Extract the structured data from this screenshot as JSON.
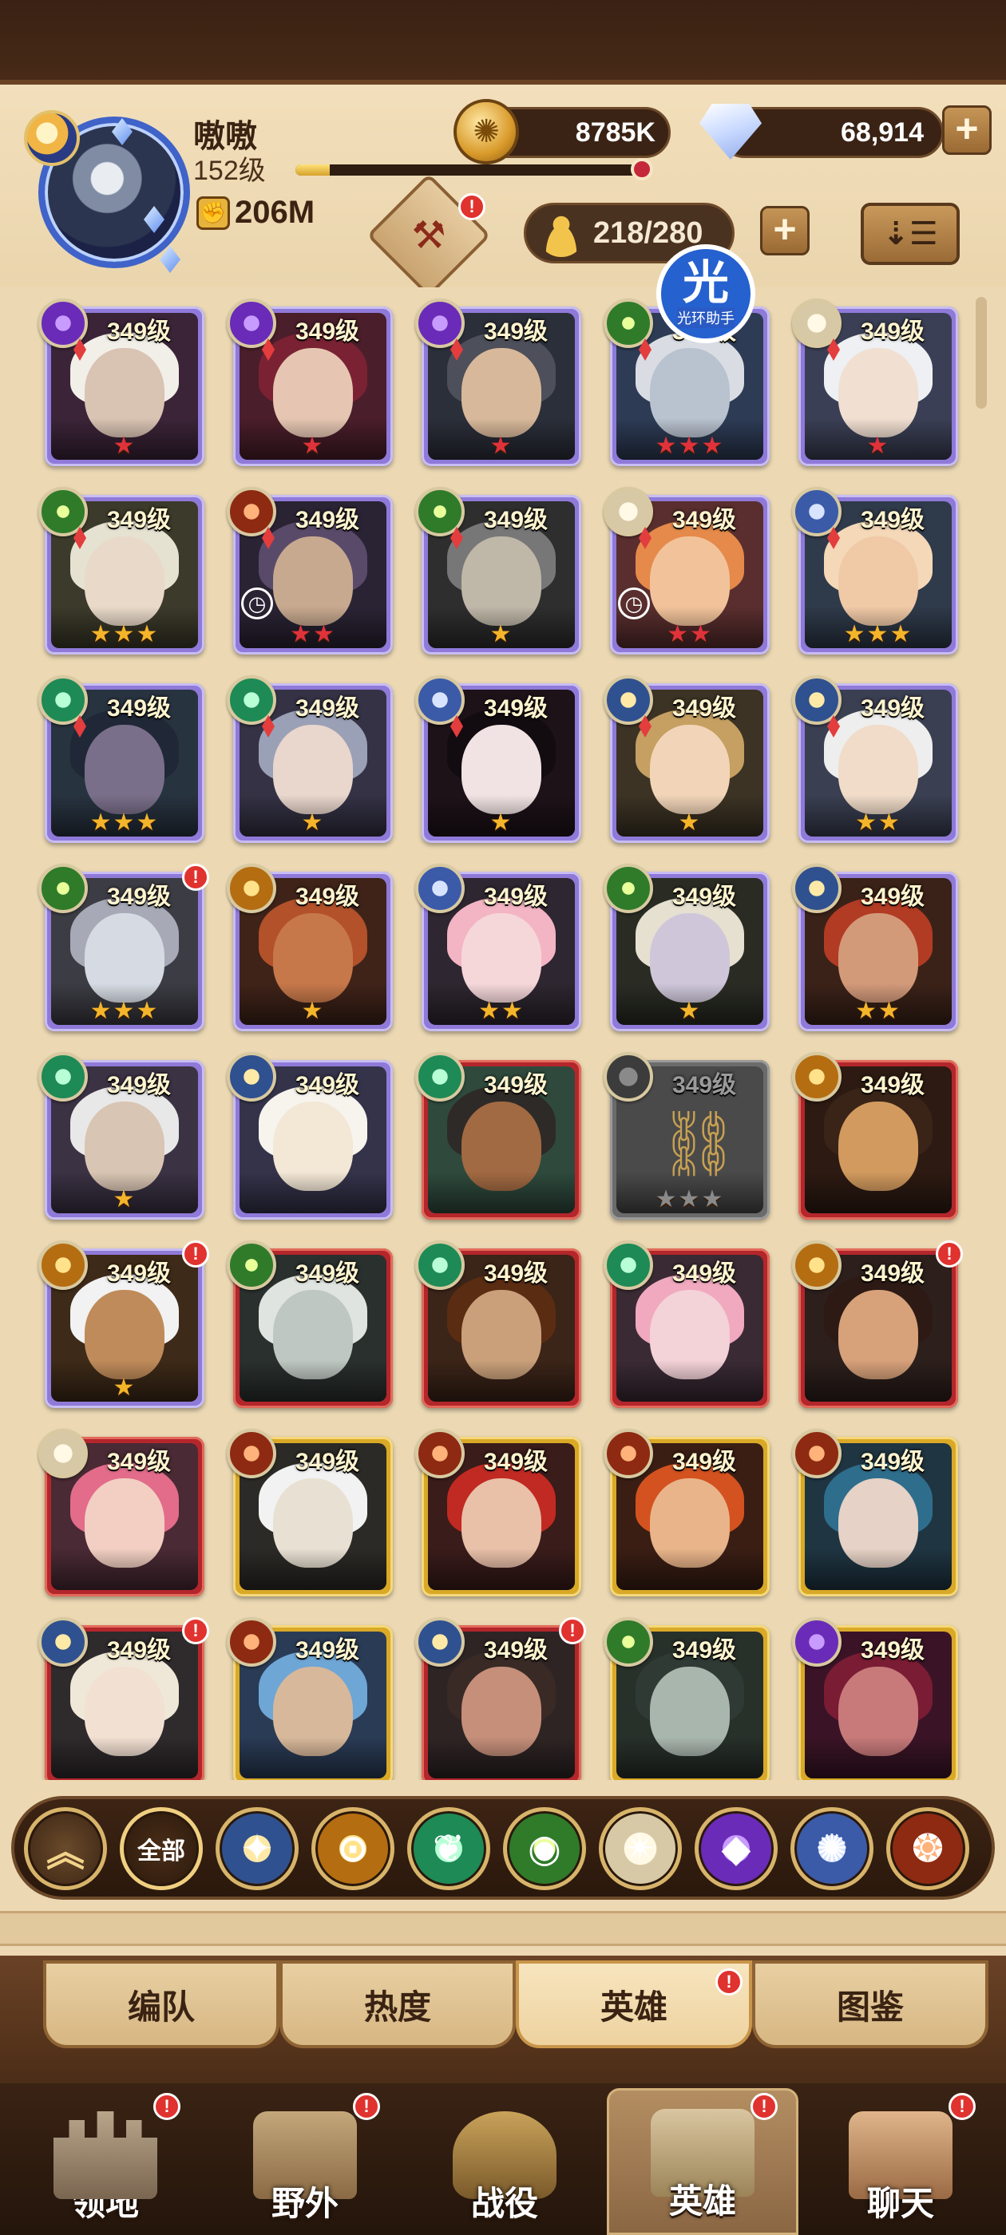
{
  "player": {
    "name": "嗷嗷",
    "level": "152级",
    "power": "206M",
    "xp_progress": 0.1
  },
  "currency": {
    "gold": "8785K",
    "diamonds": "68,914",
    "plus": "+"
  },
  "heroes_header": {
    "slot_count": "218/280",
    "plus": "+",
    "sort_icon": "⇣☰",
    "dismantle_badge": "!"
  },
  "helper_overlay": {
    "glyph": "光",
    "label": "光环助手"
  },
  "heroes": [
    {
      "level": "349级",
      "faction": "hypogean",
      "frame": "purple",
      "stars": "★",
      "badge": ""
    },
    {
      "level": "349级",
      "faction": "hypogean",
      "frame": "purple",
      "stars": "★",
      "badge": ""
    },
    {
      "level": "349级",
      "faction": "hypogean",
      "frame": "purple",
      "stars": "★",
      "badge": ""
    },
    {
      "level": "349级",
      "faction": "wilder",
      "frame": "purple",
      "stars": "★★★",
      "badge": ""
    },
    {
      "level": "349级",
      "faction": "celestial",
      "frame": "purple",
      "stars": "★",
      "badge": ""
    },
    {
      "level": "349级",
      "faction": "wilder",
      "frame": "purple",
      "stars": "★★★",
      "badge": ""
    },
    {
      "level": "349级",
      "faction": "graveborn",
      "frame": "purple",
      "stars": "★★",
      "badge": "",
      "clock": "◷"
    },
    {
      "level": "349级",
      "faction": "wilder",
      "frame": "purple",
      "stars": "★",
      "badge": ""
    },
    {
      "level": "349级",
      "faction": "celestial",
      "frame": "purple",
      "stars": "★★",
      "badge": "",
      "clock": "◷"
    },
    {
      "level": "349级",
      "faction": "dimensional",
      "frame": "purple",
      "stars": "★★★",
      "badge": ""
    },
    {
      "level": "349级",
      "faction": "maulers",
      "frame": "purple",
      "stars": "★★★",
      "badge": ""
    },
    {
      "level": "349级",
      "faction": "maulers",
      "frame": "purple",
      "stars": "★",
      "badge": ""
    },
    {
      "level": "349级",
      "faction": "dimensional",
      "frame": "purple",
      "stars": "★",
      "badge": ""
    },
    {
      "level": "349级",
      "faction": "lightbearer",
      "frame": "purple",
      "stars": "★",
      "badge": ""
    },
    {
      "level": "349级",
      "faction": "lightbearer",
      "frame": "purple",
      "stars": "★★",
      "badge": ""
    },
    {
      "level": "349级",
      "faction": "wilder",
      "frame": "purple",
      "stars": "★★★",
      "badge": "!"
    },
    {
      "level": "349级",
      "faction": "mauler2",
      "frame": "purple",
      "stars": "★",
      "badge": ""
    },
    {
      "level": "349级",
      "faction": "dimensional",
      "frame": "purple",
      "stars": "★★",
      "badge": ""
    },
    {
      "level": "349级",
      "faction": "wilder",
      "frame": "purple",
      "stars": "★",
      "badge": ""
    },
    {
      "level": "349级",
      "faction": "lightbearer",
      "frame": "purple",
      "stars": "★★",
      "badge": ""
    },
    {
      "level": "349级",
      "faction": "maulers",
      "frame": "purple",
      "stars": "★",
      "badge": ""
    },
    {
      "level": "349级",
      "faction": "lightbearer",
      "frame": "purple",
      "stars": "",
      "badge": ""
    },
    {
      "level": "349级",
      "faction": "maulers",
      "frame": "red",
      "stars": "",
      "badge": ""
    },
    {
      "level": "349级",
      "faction": "locked",
      "frame": "grey",
      "stars": "★★★",
      "badge": "",
      "locked": true
    },
    {
      "level": "349级",
      "faction": "mauler2",
      "frame": "red",
      "stars": "",
      "badge": ""
    },
    {
      "level": "349级",
      "faction": "mauler2",
      "frame": "purple",
      "stars": "★",
      "badge": "!"
    },
    {
      "level": "349级",
      "faction": "wilder",
      "frame": "red",
      "stars": "",
      "badge": ""
    },
    {
      "level": "349级",
      "faction": "maulers",
      "frame": "red",
      "stars": "",
      "badge": ""
    },
    {
      "level": "349级",
      "faction": "maulers",
      "frame": "red",
      "stars": "",
      "badge": ""
    },
    {
      "level": "349级",
      "faction": "mauler2",
      "frame": "red",
      "stars": "",
      "badge": "!"
    },
    {
      "level": "349级",
      "faction": "celestial",
      "frame": "red",
      "stars": "",
      "badge": ""
    },
    {
      "level": "349级",
      "faction": "graveborn",
      "frame": "gold",
      "stars": "",
      "badge": ""
    },
    {
      "level": "349级",
      "faction": "graveborn",
      "frame": "gold",
      "stars": "",
      "badge": ""
    },
    {
      "level": "349级",
      "faction": "graveborn",
      "frame": "gold",
      "stars": "",
      "badge": ""
    },
    {
      "level": "349级",
      "faction": "graveborn",
      "frame": "gold",
      "stars": "",
      "badge": ""
    },
    {
      "level": "349级",
      "faction": "lightbearer",
      "frame": "red",
      "stars": "",
      "badge": "!"
    },
    {
      "level": "349级",
      "faction": "graveborn",
      "frame": "gold",
      "stars": "",
      "badge": ""
    },
    {
      "level": "349级",
      "faction": "lightbearer",
      "frame": "red",
      "stars": "",
      "badge": "!"
    },
    {
      "level": "349级",
      "faction": "wilder",
      "frame": "gold",
      "stars": "",
      "badge": ""
    },
    {
      "level": "349级",
      "faction": "hypogean",
      "frame": "gold",
      "stars": "",
      "badge": ""
    }
  ],
  "filters": [
    {
      "name": "filter-rank-up",
      "label": "︽",
      "kind": "rank"
    },
    {
      "name": "filter-all",
      "label": "全部",
      "kind": "all"
    },
    {
      "name": "filter-lightbearer",
      "label": "✦",
      "kind": "lightbearer"
    },
    {
      "name": "filter-mauler",
      "label": "⊙",
      "kind": "mauler2"
    },
    {
      "name": "filter-wilder",
      "label": "❦",
      "kind": "maulers"
    },
    {
      "name": "filter-graveborn",
      "label": "◉",
      "kind": "wilder"
    },
    {
      "name": "filter-celestial",
      "label": "✴",
      "kind": "celestial"
    },
    {
      "name": "filter-hypogean",
      "label": "◆",
      "kind": "hypogean"
    },
    {
      "name": "filter-dimensional",
      "label": "✺",
      "kind": "dimensional"
    },
    {
      "name": "filter-special",
      "label": "❂",
      "kind": "graveborn"
    }
  ],
  "subtabs": [
    {
      "label": "编队",
      "active": false,
      "badge": ""
    },
    {
      "label": "热度",
      "active": false,
      "badge": ""
    },
    {
      "label": "英雄",
      "active": true,
      "badge": "!"
    },
    {
      "label": "图鉴",
      "active": false,
      "badge": ""
    }
  ],
  "nav": [
    {
      "label": "领地",
      "badge": "!",
      "active": false
    },
    {
      "label": "野外",
      "badge": "!",
      "active": false
    },
    {
      "label": "战役",
      "badge": "",
      "active": false
    },
    {
      "label": "英雄",
      "badge": "!",
      "active": true
    },
    {
      "label": "聊天",
      "badge": "!",
      "active": false
    }
  ],
  "colors": {
    "frame_purple": "#8f7ad9",
    "frame_red": "#b3262b",
    "frame_gold": "#d9a927",
    "frame_grey": "#6b6b6b",
    "star": "#f5b52a",
    "star_red": "#e0323b",
    "badge": "#e0322e"
  }
}
